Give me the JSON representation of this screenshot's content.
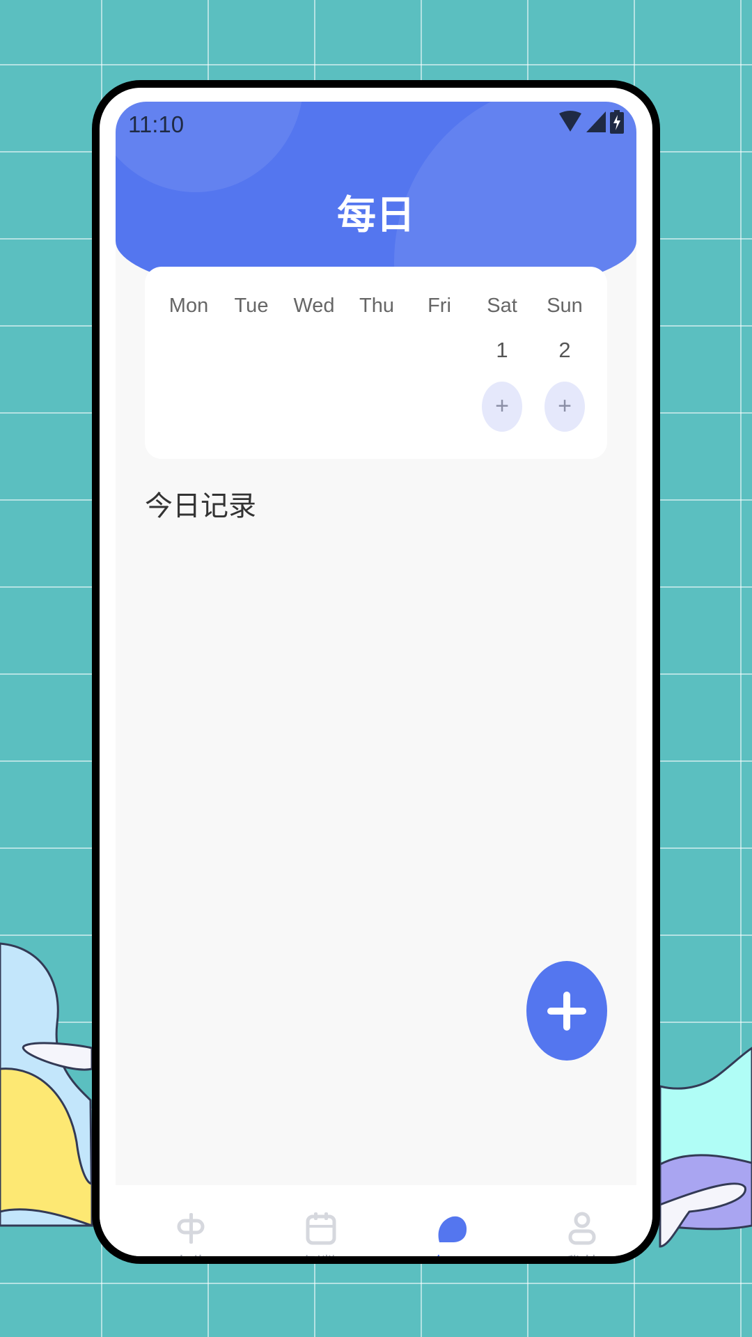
{
  "status_bar": {
    "time": "11:10",
    "icons": [
      "wifi-icon",
      "signal-icon",
      "battery-charging-icon"
    ]
  },
  "header": {
    "title": "每日"
  },
  "week": {
    "days": [
      {
        "name": "Mon",
        "date": ""
      },
      {
        "name": "Tue",
        "date": ""
      },
      {
        "name": "Wed",
        "date": ""
      },
      {
        "name": "Thu",
        "date": ""
      },
      {
        "name": "Fri",
        "date": ""
      },
      {
        "name": "Sat",
        "date": "1",
        "add": "+"
      },
      {
        "name": "Sun",
        "date": "2",
        "add": "+"
      }
    ]
  },
  "section": {
    "title": "今日记录"
  },
  "fab": {
    "icon": "plus-icon"
  },
  "tabs": [
    {
      "label": "人生",
      "icon": "signpost-icon",
      "active": false
    },
    {
      "label": "倒数",
      "icon": "calendar-icon",
      "active": false
    },
    {
      "label": "每日",
      "icon": "cloud-icon",
      "active": true
    },
    {
      "label": "我的",
      "icon": "person-icon",
      "active": false
    }
  ],
  "colors": {
    "accent": "#5476ef",
    "background": "#5bbfc0",
    "inactive_tab": "#a6aab6"
  }
}
